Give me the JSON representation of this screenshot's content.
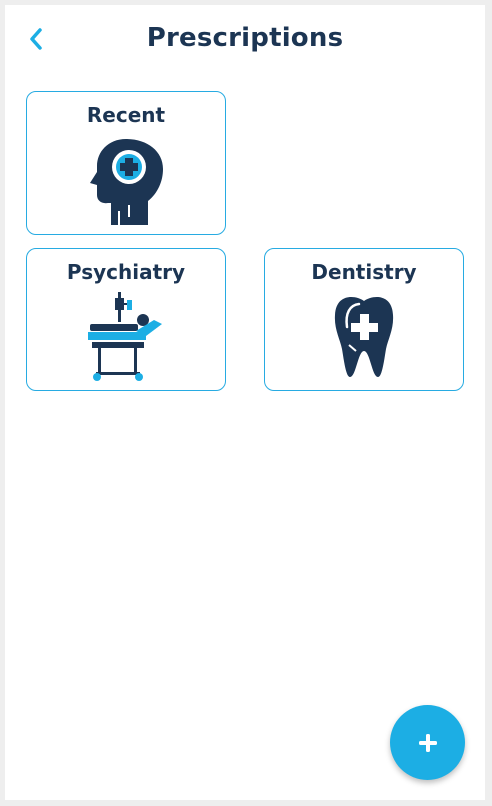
{
  "header": {
    "title": "Prescriptions",
    "back_icon": "chevron-left-icon"
  },
  "categories": [
    {
      "label": "Recent",
      "icon": "head-medical-cross-icon"
    },
    {
      "label": "Psychiatry",
      "icon": "hospital-bed-patient-icon"
    },
    {
      "label": "Dentistry",
      "icon": "tooth-medical-cross-icon"
    }
  ],
  "fab": {
    "icon": "plus-icon"
  },
  "colors": {
    "primary_dark": "#1c3553",
    "accent": "#1caee4",
    "card_border": "#27abe2",
    "background": "#ffffff"
  }
}
